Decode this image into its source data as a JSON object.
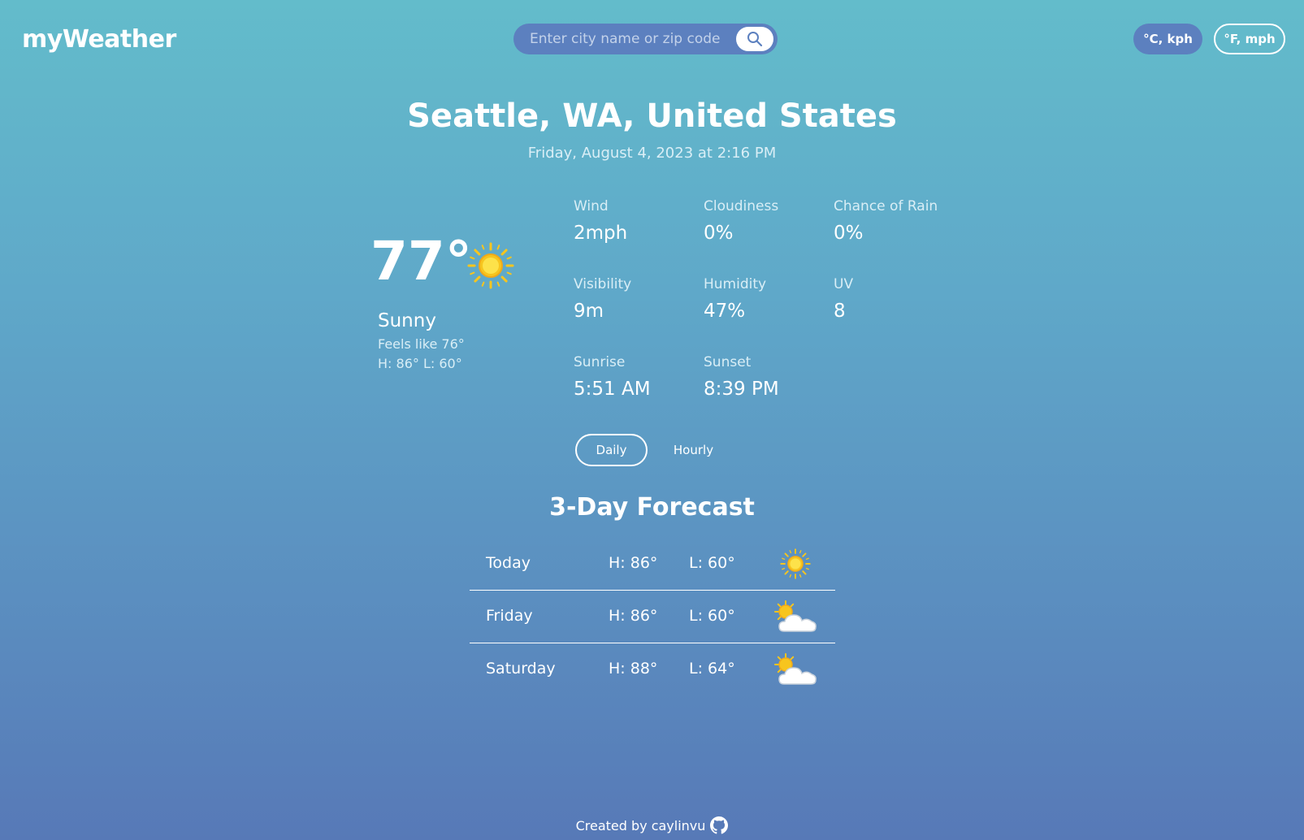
{
  "app": {
    "title": "myWeather"
  },
  "search": {
    "placeholder": "Enter city name or zip code",
    "icon": "search-icon"
  },
  "units": {
    "metric_label": "°C, kph",
    "imperial_label": "°F, mph",
    "selected": "imperial"
  },
  "location": {
    "name": "Seattle, WA, United States",
    "datetime": "Friday, August 4, 2023 at 2:16 PM"
  },
  "current": {
    "temp": "77°",
    "icon": "sun-icon",
    "condition": "Sunny",
    "feels_like": "Feels like 76°",
    "hilo": "H: 86° L: 60°"
  },
  "stats": [
    {
      "label": "Wind",
      "value": "2mph"
    },
    {
      "label": "Cloudiness",
      "value": "0%"
    },
    {
      "label": "Chance of Rain",
      "value": "0%"
    },
    {
      "label": "Visibility",
      "value": "9m"
    },
    {
      "label": "Humidity",
      "value": "47%"
    },
    {
      "label": "UV",
      "value": "8"
    },
    {
      "label": "Sunrise",
      "value": "5:51 AM"
    },
    {
      "label": "Sunset",
      "value": "8:39 PM"
    }
  ],
  "view_toggle": {
    "daily": "Daily",
    "hourly": "Hourly",
    "selected": "daily"
  },
  "forecast": {
    "title": "3-Day Forecast",
    "days": [
      {
        "day": "Today",
        "high": "H: 86°",
        "low": "L: 60°",
        "icon": "sun-icon"
      },
      {
        "day": "Friday",
        "high": "H: 86°",
        "low": "L: 60°",
        "icon": "partly-cloudy-icon"
      },
      {
        "day": "Saturday",
        "high": "H: 88°",
        "low": "L: 64°",
        "icon": "partly-cloudy-icon"
      }
    ]
  },
  "footer": {
    "text": "Created by caylinvu",
    "icon": "github-icon"
  },
  "colors": {
    "gradient_top": "#63bccb",
    "gradient_bottom": "#5779b7",
    "button_fill": "#5c80bf",
    "sun": "#f7c51e",
    "cloud": "#ffffff"
  }
}
